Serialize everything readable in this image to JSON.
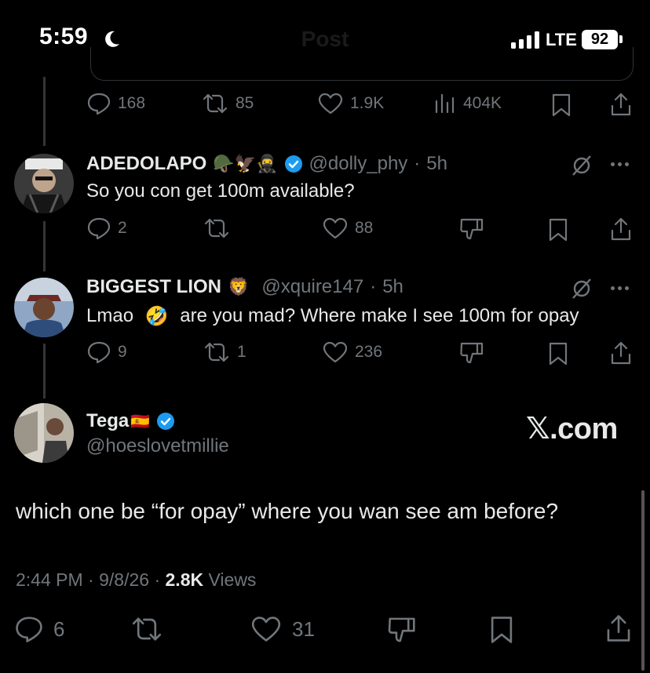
{
  "status_bar": {
    "time": "5:59",
    "network": "LTE",
    "battery": "92",
    "icons": [
      "moon-icon",
      "signal-icon",
      "battery-icon"
    ]
  },
  "header": {
    "title": "Post"
  },
  "top_actions": {
    "replies": "168",
    "reposts": "85",
    "likes": "1.9K",
    "views": "404K"
  },
  "replies": [
    {
      "name": "ADEDOLAPO",
      "emojis": "🪖🦅🥷",
      "handle": "@dolly_phy",
      "time": "5h",
      "text": "So you con get 100m available?",
      "reply_count": "2",
      "repost_count": "",
      "like_count": "88"
    },
    {
      "name": "BIGGEST LION",
      "emojis": "🦁",
      "handle": "@xquire147",
      "time": "5h",
      "text_before": "Lmao",
      "text_emoji": "🤣",
      "text_after": "are you mad? Where make I see 100m for opay",
      "reply_count": "9",
      "repost_count": "1",
      "like_count": "236"
    }
  ],
  "main_post": {
    "name": "Tega",
    "flag": "🇪🇸",
    "handle": "@hoeslovetmillie",
    "text": "which one be “for opay” where you wan see am before?",
    "time": "2:44 PM",
    "date": "9/8/26",
    "views": "2.8K",
    "views_label": "Views",
    "reply_count": "6",
    "like_count": "31"
  },
  "watermark": "𝕏.com",
  "colors": {
    "background": "#000000",
    "text": "#e7e9ea",
    "muted": "#71767b",
    "verified": "#1d9bf0",
    "divider": "#2f3336"
  }
}
